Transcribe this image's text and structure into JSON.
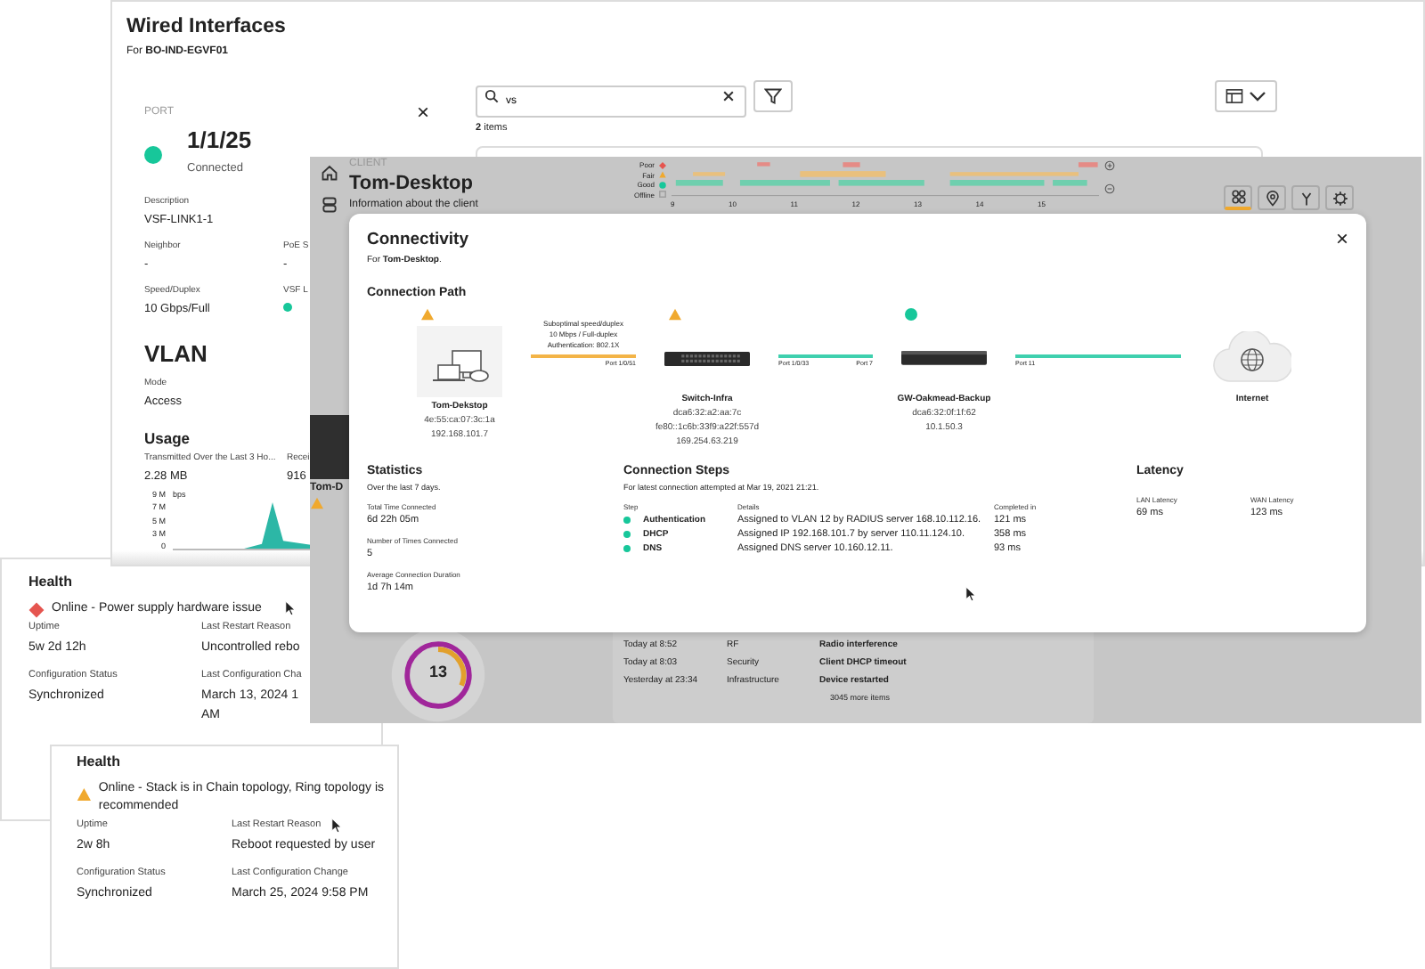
{
  "wired_window": {
    "title": "Wired Interfaces",
    "subtitle": "For **BO-IND-EGVF01**",
    "port": {
      "section_label": "PORT",
      "close_label": "×",
      "name": "1/1/25",
      "status": "Connected",
      "connected": true,
      "fields": [
        {
          "label": "Description",
          "value": "VSF-LINK1-1",
          "kind": "wide"
        },
        {
          "label": "Neighbor",
          "value": "-",
          "kind": "text"
        },
        {
          "label": "PoE S",
          "value": "-",
          "kind": "text"
        },
        {
          "label": "Speed/Duplex",
          "value": "10 Gbps/Full",
          "kind": "text"
        },
        {
          "label": "VSF L",
          "kind": "dot"
        }
      ]
    },
    "vlan": {
      "title": "VLAN",
      "fields": [
        {
          "label": "Mode",
          "value": "Access"
        }
      ]
    },
    "usage": {
      "title": "Usage",
      "fields": [
        {
          "label": "Transmitted Over the Last 3 Ho...",
          "value": "2.28 MB"
        },
        {
          "label": "Recei",
          "value": "916"
        }
      ],
      "unit": "bps",
      "y_labels": [
        "9 M",
        "7 M",
        "5 M",
        "3 M",
        "0"
      ]
    },
    "search": {
      "value": "vs"
    },
    "item_count": "**2** items"
  },
  "client_window": {
    "section_label": "CLIENT",
    "title": "Tom-Desktop",
    "description": "Information about the client",
    "legend": [
      {
        "label": "Poor",
        "kind": "poor"
      },
      {
        "label": "Fair",
        "kind": "fair"
      },
      {
        "label": "Good",
        "kind": "good"
      },
      {
        "label": "Offline",
        "kind": "offline"
      }
    ],
    "x_labels": [
      "9",
      "10",
      "11",
      "12",
      "13",
      "14",
      "15"
    ],
    "toolbar": [
      {
        "selected": true
      },
      {
        "selected": false
      },
      {
        "selected": false
      },
      {
        "selected": false
      }
    ],
    "device_name": "Tom-D",
    "health_score": "13",
    "events": [
      {
        "time": "Today at 8:52",
        "category": "RF",
        "event": "Radio interference"
      },
      {
        "time": "Today at 8:03",
        "category": "Security",
        "event": "Client DHCP timeout"
      },
      {
        "time": "Yesterday at 23:34",
        "category": "Infrastructure",
        "event": "Device restarted"
      }
    ],
    "more": "3045 more items"
  },
  "modal": {
    "title": "Connectivity",
    "close_label": "×",
    "subtitle": "For **Tom-Desktop**.",
    "path_title": "Connection Path",
    "nodes": [
      {
        "kind": "client",
        "warning": true,
        "healthy": false,
        "name": "Tom-Dekstop",
        "details": [
          "4e:55:ca:07:3c:1a",
          "192.168.101.7"
        ]
      },
      {
        "kind": "switch",
        "warning": true,
        "healthy": false,
        "name": "Switch-Infra",
        "details": [
          "dca6:32:a2:aa:7c",
          "fe80::1c6b:33f9:a22f:557d",
          "169.254.63.219"
        ]
      },
      {
        "kind": "gateway",
        "warning": false,
        "healthy": true,
        "name": "GW-Oakmead-Backup",
        "details": [
          "dca6:32:0f:1f:62",
          "10.1.50.3"
        ]
      },
      {
        "kind": "internet",
        "warning": false,
        "healthy": false,
        "name": "Internet"
      }
    ],
    "links": [
      {
        "color": "#f3b447",
        "labels": [
          "Suboptimal speed/duplex",
          "10 Mbps / Full-duplex",
          "Authentication: 802.1X"
        ],
        "port_right": "Port 1/0/51"
      },
      {
        "color": "#3fd0ae",
        "port_left": "Port 1/0/33",
        "port_right": "Port 7"
      },
      {
        "color": "#3fd0ae",
        "port_left": "Port 11"
      }
    ],
    "statistics": {
      "title": "Statistics",
      "subtitle": "Over the last 7 days.",
      "items": [
        {
          "label": "Total Time Connected",
          "value": "6d 22h 05m"
        },
        {
          "label": "Number of Times Connected",
          "value": "5"
        },
        {
          "label": "Average Connection Duration",
          "value": "1d 7h 14m"
        }
      ]
    },
    "steps": {
      "title": "Connection Steps",
      "subtitle": "For latest connection attempted at Mar 19, 2021 21:21.",
      "columns": [
        "Step",
        "Details",
        "Completed in"
      ],
      "rows": [
        {
          "color": "#17c79a",
          "step": "Authentication",
          "details": "Assigned to VLAN 12 by RADIUS server 168.10.112.16.",
          "time": "121 ms"
        },
        {
          "color": "#17c79a",
          "step": "DHCP",
          "details": "Assigned IP 192.168.101.7 by server 110.11.124.10.",
          "time": "358 ms"
        },
        {
          "color": "#17c79a",
          "step": "DNS",
          "details": "Assigned DNS server 10.160.12.11.",
          "time": "93 ms"
        }
      ]
    },
    "latency": {
      "title": "Latency",
      "items": [
        {
          "label": "LAN Latency",
          "value": "69 ms"
        },
        {
          "label": "WAN Latency",
          "value": "123 ms"
        }
      ]
    }
  },
  "health_cards": [
    {
      "title": "Health",
      "status": {
        "kind": "error",
        "text": "Online - Power supply hardware issue"
      },
      "fields": [
        {
          "label": "Uptime",
          "value": "5w 2d 12h"
        },
        {
          "label": "Last Restart Reason",
          "value": "Uncontrolled rebo"
        },
        {
          "label": "Configuration Status",
          "value": "Synchronized"
        },
        {
          "label": "Last Configuration Cha",
          "value": "March 13, 2024 1\nAM"
        }
      ]
    },
    {
      "title": "Health",
      "status": {
        "kind": "warning",
        "text": "Online - Stack is in Chain topology, Ring topology is recommended"
      },
      "fields": [
        {
          "label": "Uptime",
          "value": "2w 8h"
        },
        {
          "label": "Last Restart Reason",
          "value": "Reboot requested by user"
        },
        {
          "label": "Configuration Status",
          "value": "Synchronized"
        },
        {
          "label": "Last Configuration Change",
          "value": "March 25, 2024 9:58 PM"
        }
      ]
    }
  ]
}
